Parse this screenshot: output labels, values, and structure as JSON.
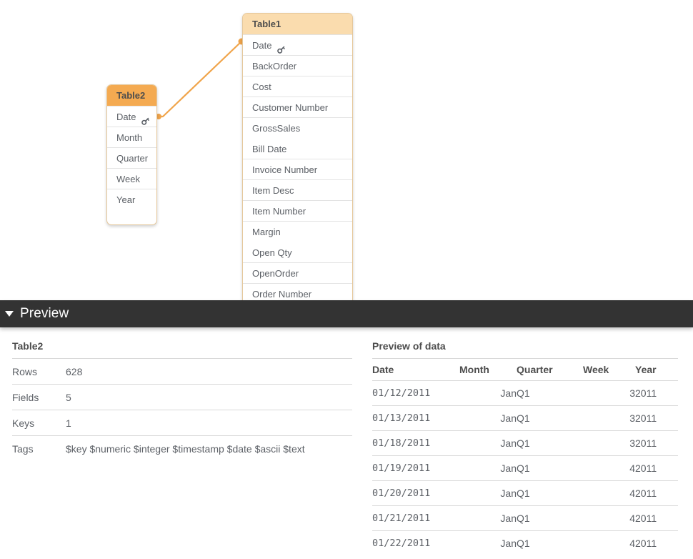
{
  "canvas": {
    "tables": [
      {
        "id": "table1",
        "name": "Table1",
        "style": "secondary",
        "fields": [
          {
            "label": "Date",
            "key": true,
            "rule": true
          },
          {
            "label": "BackOrder",
            "key": false,
            "rule": true
          },
          {
            "label": "Cost",
            "key": false,
            "rule": true
          },
          {
            "label": "Customer Number",
            "key": false,
            "rule": true
          },
          {
            "label": "GrossSales",
            "key": false,
            "rule": true
          },
          {
            "label": "Bill Date",
            "key": false,
            "rule": false
          },
          {
            "label": "Invoice Number",
            "key": false,
            "rule": true
          },
          {
            "label": "Item Desc",
            "key": false,
            "rule": true
          },
          {
            "label": "Item Number",
            "key": false,
            "rule": true
          },
          {
            "label": "Margin",
            "key": false,
            "rule": true
          },
          {
            "label": "Open Qty",
            "key": false,
            "rule": false
          },
          {
            "label": "OpenOrder",
            "key": false,
            "rule": true
          },
          {
            "label": "Order Number",
            "key": false,
            "rule": true
          }
        ]
      },
      {
        "id": "table2",
        "name": "Table2",
        "style": "primary",
        "fields": [
          {
            "label": "Date",
            "key": true,
            "rule": true
          },
          {
            "label": "Month",
            "key": false,
            "rule": true
          },
          {
            "label": "Quarter",
            "key": false,
            "rule": true
          },
          {
            "label": "Week",
            "key": false,
            "rule": true
          },
          {
            "label": "Year",
            "key": false,
            "rule": true
          }
        ]
      }
    ],
    "association": {
      "from_field": "Date",
      "from_table": "Table2",
      "to_field": "Date",
      "to_table": "Table1",
      "color": "#f0a44a"
    },
    "colors": {
      "header_primary": "#f4aa51",
      "header_secondary": "#fadcae",
      "card_border": "#e5c79a",
      "canvas_background": "#ffffff"
    }
  },
  "preview_bar": {
    "title": "Preview",
    "expanded": true,
    "background": "#333333",
    "caret_icon": "caret-down-icon"
  },
  "preview": {
    "table_summary": {
      "title": "Table2",
      "rows": [
        {
          "label": "Rows",
          "value": "628"
        },
        {
          "label": "Fields",
          "value": "5"
        },
        {
          "label": "Keys",
          "value": "1"
        },
        {
          "label": "Tags",
          "value": "$key $numeric $integer $timestamp $date $ascii $text"
        }
      ]
    },
    "data_preview": {
      "title": "Preview of data",
      "columns": [
        "Date",
        "Month",
        "Quarter",
        "Week",
        "Year"
      ],
      "rows": [
        [
          "01/12/2011",
          "Jan",
          "Q1",
          "3",
          "2011"
        ],
        [
          "01/13/2011",
          "Jan",
          "Q1",
          "3",
          "2011"
        ],
        [
          "01/18/2011",
          "Jan",
          "Q1",
          "3",
          "2011"
        ],
        [
          "01/19/2011",
          "Jan",
          "Q1",
          "4",
          "2011"
        ],
        [
          "01/20/2011",
          "Jan",
          "Q1",
          "4",
          "2011"
        ],
        [
          "01/21/2011",
          "Jan",
          "Q1",
          "4",
          "2011"
        ],
        [
          "01/22/2011",
          "Jan",
          "Q1",
          "4",
          "2011"
        ]
      ]
    }
  }
}
